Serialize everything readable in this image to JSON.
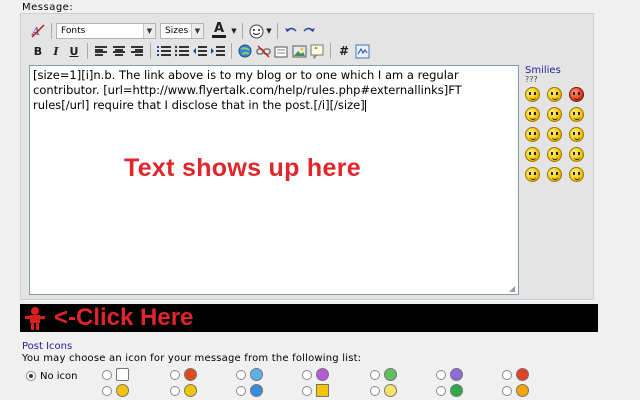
{
  "message_label": "Message:",
  "toolbar": {
    "font_select": "Fonts",
    "size_select": "Sizes",
    "color_letter": "A",
    "bold": "B",
    "italic": "I",
    "underline": "U",
    "hash": "#"
  },
  "editor": {
    "text": "[size=1][i]n.b. The link above is to my blog or to one which I am a regular contributor. [url=http://www.flyertalk.com/help/rules.php#externallinks]FT rules[/url] require that I disclose that in the post.[/i][/size]"
  },
  "overlay": {
    "text": "Text shows up here",
    "color": "#e0252b"
  },
  "smilies": {
    "title": "Smilies",
    "more": "???"
  },
  "click_banner": {
    "text": "<-Click Here"
  },
  "post_icons": {
    "title": "Post Icons",
    "description": "You may choose an icon for your message from the following list:",
    "no_icon_label": "No icon"
  }
}
